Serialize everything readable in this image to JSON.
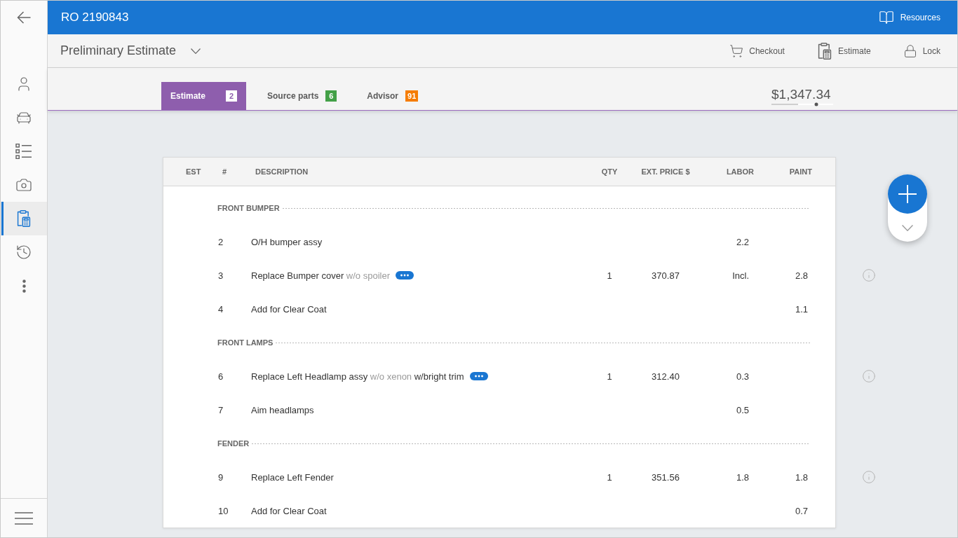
{
  "sidebar": {
    "items": [
      {
        "selected": false
      },
      {
        "selected": false
      },
      {
        "selected": false
      },
      {
        "selected": false
      },
      {
        "selected": true
      },
      {
        "selected": false
      },
      {
        "selected": false
      }
    ]
  },
  "header": {
    "title": "RO 2190843",
    "resources": "Resources"
  },
  "toolbar": {
    "title": "Preliminary Estimate",
    "actions": [
      "Checkout",
      "Estimate",
      "Lock"
    ]
  },
  "tabs": [
    {
      "label": "Estimate",
      "count": "2",
      "color": "#8e5ead",
      "selected": true
    },
    {
      "label": "Source parts",
      "count": "6",
      "color": "#43a047",
      "selected": false
    },
    {
      "label": "Advisor",
      "count": "91",
      "color": "#f57c00",
      "selected": false
    }
  ],
  "total": "$1,347.34",
  "table": {
    "columns": [
      "EST",
      "#",
      "DESCRIPTION",
      "QTY",
      "EXT. PRICE $",
      "LABOR",
      "PAINT"
    ],
    "groups": [
      {
        "title": "FRONT BUMPER",
        "items": [
          {
            "number": "2",
            "description": [
              {
                "text": "O/H bumper assy",
                "muted": false
              }
            ],
            "labor": "2.2",
            "options": false,
            "info": false
          },
          {
            "number": "3",
            "description": [
              {
                "text": "Replace Bumper cover",
                "muted": false
              },
              {
                "text": "w/o spoiler",
                "muted": true
              }
            ],
            "qty": "1",
            "price": "370.87",
            "labor": "Incl.",
            "paint": "2.8",
            "options": true,
            "info": true
          },
          {
            "number": "4",
            "description": [
              {
                "text": "Add for Clear Coat",
                "muted": false
              }
            ],
            "paint": "1.1",
            "options": false,
            "info": false
          }
        ]
      },
      {
        "title": "FRONT LAMPS",
        "items": [
          {
            "number": "6",
            "description": [
              {
                "text": "Replace Left Headlamp assy",
                "muted": false
              },
              {
                "text": "w/o xenon",
                "muted": true
              },
              {
                "text": "w/bright trim",
                "muted": false
              }
            ],
            "qty": "1",
            "price": "312.40",
            "labor": "0.3",
            "options": true,
            "info": true
          },
          {
            "number": "7",
            "description": [
              {
                "text": "Aim headlamps",
                "muted": false
              }
            ],
            "labor": "0.5",
            "options": false,
            "info": false
          }
        ]
      },
      {
        "title": "FENDER",
        "items": [
          {
            "number": "9",
            "description": [
              {
                "text": "Replace Left Fender",
                "muted": false
              }
            ],
            "qty": "1",
            "price": "351.56",
            "labor": "1.8",
            "paint": "1.8",
            "options": false,
            "info": true
          },
          {
            "number": "10",
            "description": [
              {
                "text": "Add for Clear Coat",
                "muted": false
              }
            ],
            "paint": "0.7",
            "options": false,
            "info": false
          }
        ]
      }
    ]
  }
}
